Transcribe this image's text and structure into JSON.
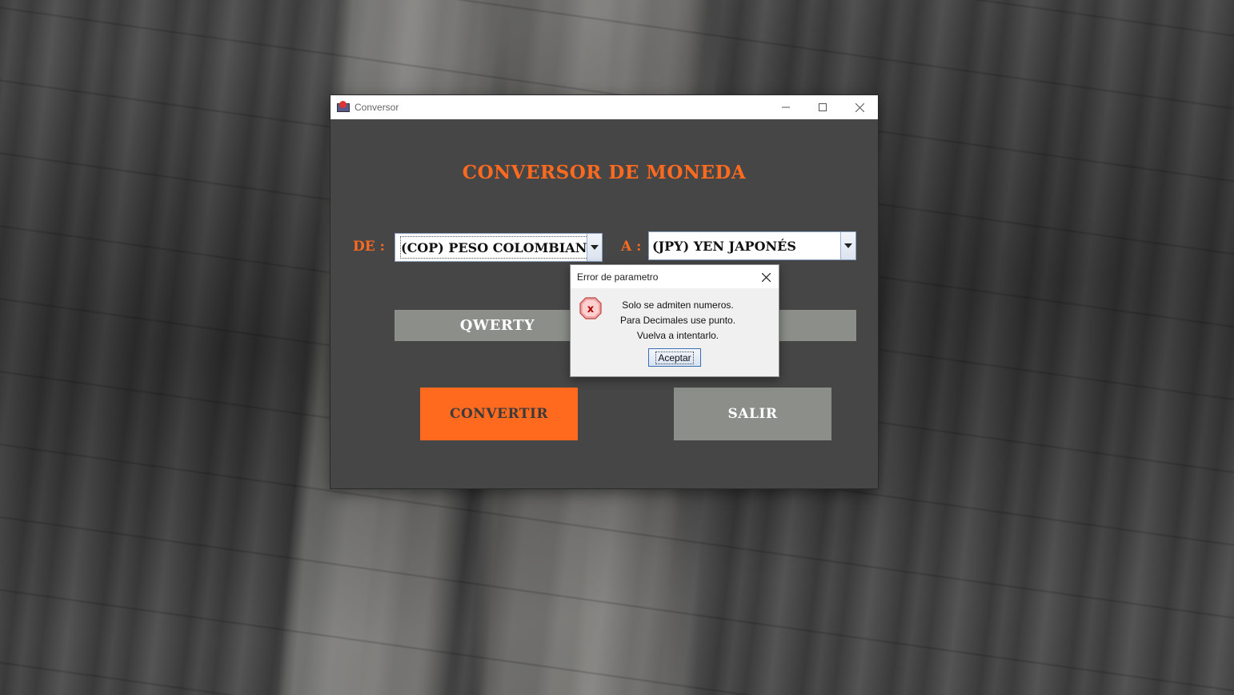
{
  "window": {
    "title": "Conversor",
    "heading": "CONVERSOR DE MONEDA",
    "from_label": "DE :",
    "from_value": "(COP) PESO COLOMBIANO",
    "to_label": "A :",
    "to_value": "(JPY) YEN JAPONÉS",
    "input_value": "QWERTY",
    "convert_label": "CONVERTIR",
    "exit_label": "SALIR"
  },
  "dialog": {
    "title": "Error de parametro",
    "line1": "Solo se admiten numeros.",
    "line2": "Para Decimales use punto.",
    "line3": "Vuelva a intentarlo.",
    "ok_label": "Aceptar",
    "icon": "error-icon"
  },
  "colors": {
    "accent": "#ff6a1f",
    "panel": "#464646",
    "field": "#8b8e89"
  }
}
